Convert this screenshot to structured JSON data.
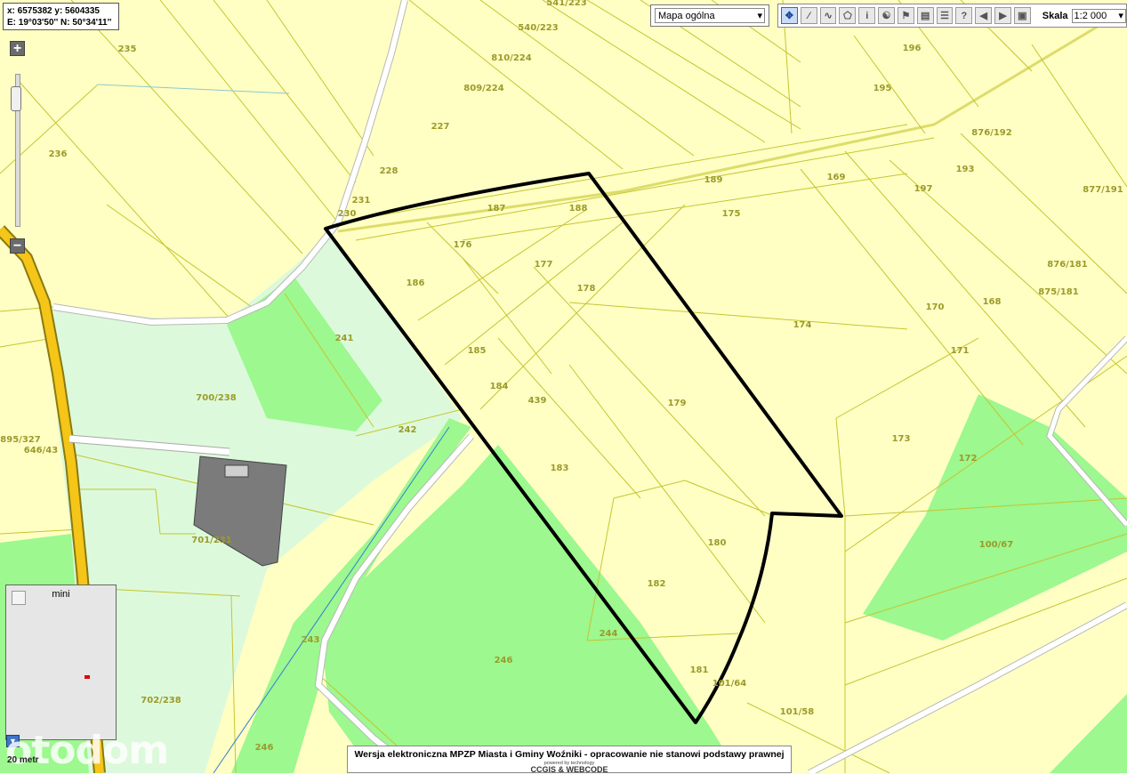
{
  "coordinates": {
    "line1": "x: 6575382 y: 5604335",
    "line2": "E: 19°03'50'' N: 50°34'11''"
  },
  "zoom": {
    "in_label": "+",
    "out_label": "−"
  },
  "layer_select": {
    "value": "Mapa ogólna"
  },
  "toolbar": {
    "tools": [
      "pan-icon",
      "measure-distance-icon",
      "measure-path-icon",
      "measure-area-icon",
      "info-icon",
      "globe-icon",
      "print-icon",
      "legend-icon",
      "layers-icon",
      "help-icon",
      "previous-view-icon",
      "next-view-icon",
      "full-extent-icon"
    ],
    "help_glyph": "?",
    "info_glyph": "i",
    "scale_label": "Skala",
    "scale_value": "1:2 000"
  },
  "minimap": {
    "title": "mini"
  },
  "scalebar": {
    "label": "20 metr"
  },
  "watermark": "otodom",
  "footer": {
    "main": "Wersja elektroniczna MPZP Miasta i Gminy Woźniki - opracowanie nie stanowi podstawy prawnej",
    "powered": "powered by technology",
    "logo": "CCGIS & WEBCODE"
  },
  "map": {
    "colors": {
      "farmland": "#ffffc4",
      "forest": "#9cf88f",
      "meadow": "#dcfadb",
      "road_main": "#f5c518",
      "building": "#7b7b7b",
      "parcel_line": "#c6c430",
      "selection": "#000000"
    },
    "parcel_labels": [
      "235",
      "236",
      "227",
      "228",
      "231",
      "230",
      "541/223",
      "540/223",
      "810/224",
      "809/224",
      "196",
      "195",
      "876/192",
      "193",
      "877/191",
      "197",
      "189",
      "169",
      "176",
      "187",
      "188",
      "175",
      "177",
      "178",
      "186",
      "185",
      "184",
      "439",
      "183",
      "179",
      "174",
      "170",
      "168",
      "171",
      "173",
      "172",
      "876/181",
      "875/181",
      "700/238",
      "241",
      "242",
      "895/327",
      "646/43",
      "701/231",
      "180",
      "182",
      "244",
      "181",
      "101/64",
      "101/58",
      "100/67",
      "243",
      "246",
      "702/238",
      "246"
    ]
  }
}
